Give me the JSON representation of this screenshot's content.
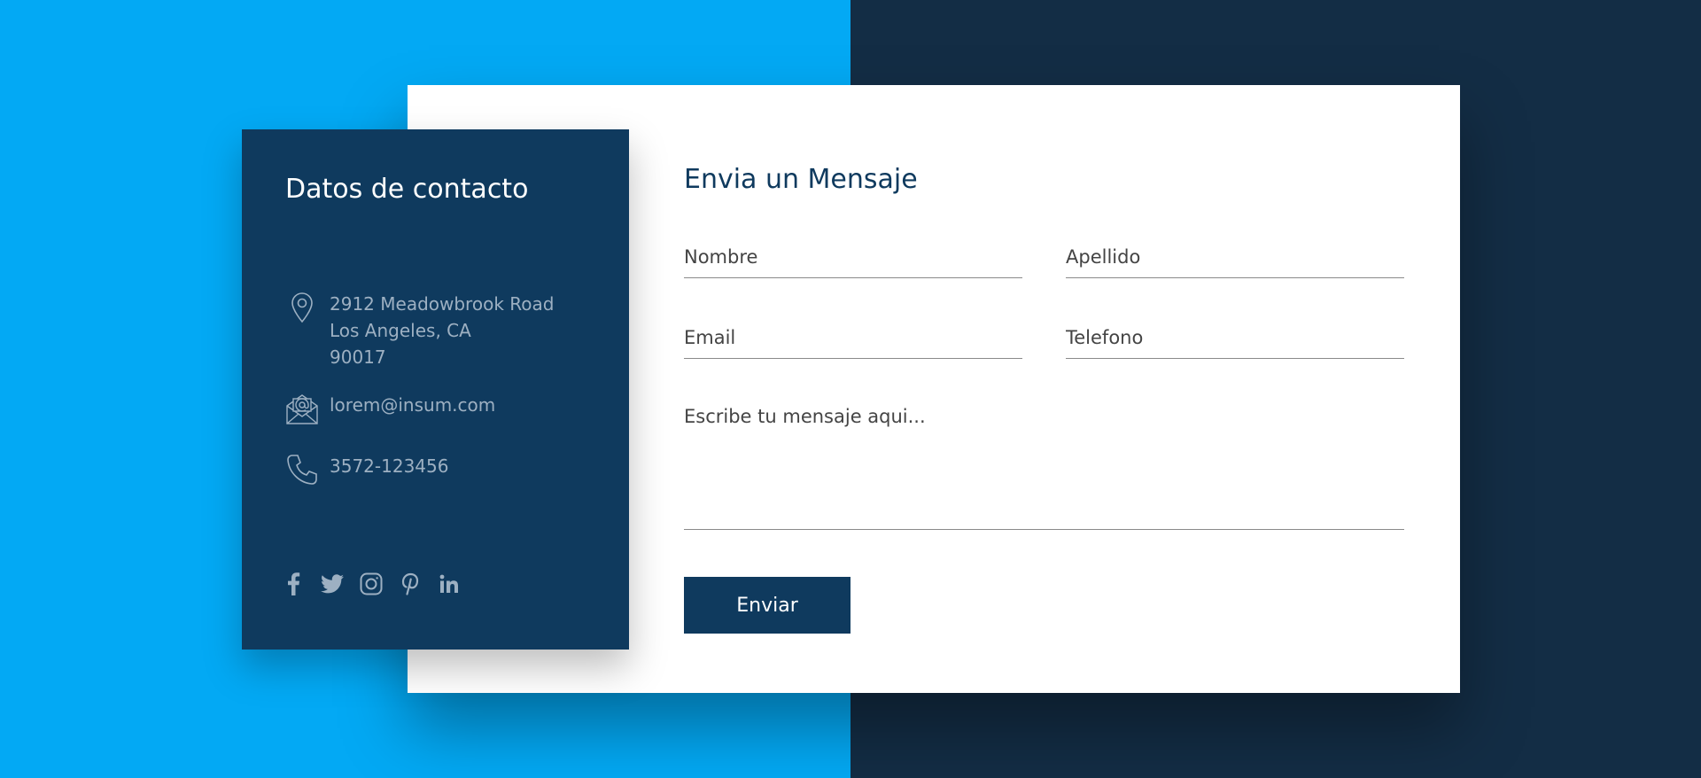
{
  "colors": {
    "bg_left": "#03a9f4",
    "bg_right": "#132d45",
    "panel": "#0f3a5e",
    "accent_text": "#0f3a5e",
    "muted_text": "#9db0c2",
    "card": "#ffffff"
  },
  "contact": {
    "title": "Datos de contacto",
    "address": {
      "icon": "map-pin-icon",
      "line1": "2912 Meadowbrook Road",
      "line2": "Los Angeles, CA",
      "line3": "90017"
    },
    "email": {
      "icon": "envelope-at-icon",
      "value": "lorem@insum.com"
    },
    "phone": {
      "icon": "phone-icon",
      "value": "3572-123456"
    },
    "socials": [
      "facebook-icon",
      "twitter-icon",
      "instagram-icon",
      "pinterest-icon",
      "linkedin-icon"
    ]
  },
  "form": {
    "title": "Envia un Mensaje",
    "nombre_placeholder": "Nombre",
    "apellido_placeholder": "Apellido",
    "email_placeholder": "Email",
    "telefono_placeholder": "Telefono",
    "mensaje_placeholder": "Escribe tu mensaje aqui...",
    "submit_label": "Enviar"
  }
}
